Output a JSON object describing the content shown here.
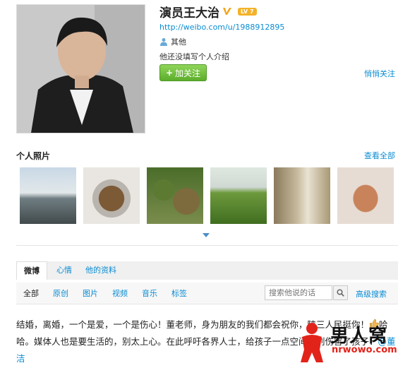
{
  "profile": {
    "name": "演员王大治",
    "level": "LV 7",
    "url": "http://weibo.com/u/1988912895",
    "gender_label": "其他",
    "bio": "他还没填写个人介绍",
    "follow_label": "加关注",
    "quiet_follow_label": "悄悄关注"
  },
  "photos": {
    "title": "个人照片",
    "view_all": "查看全部"
  },
  "tabs": [
    {
      "label": "微博"
    },
    {
      "label": "心情"
    },
    {
      "label": "他的资料"
    }
  ],
  "filters": [
    {
      "label": "全部"
    },
    {
      "label": "原创"
    },
    {
      "label": "图片"
    },
    {
      "label": "视频"
    },
    {
      "label": "音乐"
    },
    {
      "label": "标签"
    }
  ],
  "search": {
    "placeholder": "搜索他说的话",
    "advanced_label": "高级搜索"
  },
  "post": {
    "text_part1": "结婚，离婚，一个是爱，一个是伤心！董老师，身为朋友的我们都会祝你，陕三人民挺你！",
    "text_part2": "哈哈。媒体人也是要生活的，别太上心。在此呼吁各界人士，给孩子一点空间，别伤害了孩子！",
    "mention": "@董洁"
  },
  "watermark": {
    "brand": "男人窝",
    "url": "nrwowo.com"
  },
  "colors": {
    "link": "#0a8cd2",
    "follow_green": "#5cad2b",
    "level_badge": "#f3b22a",
    "watermark_red": "#e2231a"
  }
}
